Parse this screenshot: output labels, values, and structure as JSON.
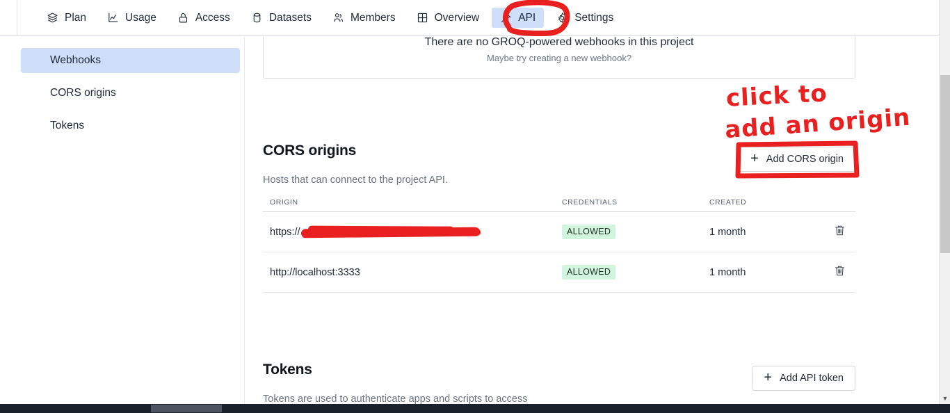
{
  "topnav": {
    "items": [
      {
        "label": "Plan",
        "icon": "layers-icon",
        "active": false
      },
      {
        "label": "Usage",
        "icon": "chart-line-icon",
        "active": false
      },
      {
        "label": "Access",
        "icon": "lock-icon",
        "active": false
      },
      {
        "label": "Datasets",
        "icon": "database-icon",
        "active": false
      },
      {
        "label": "Members",
        "icon": "users-icon",
        "active": false
      },
      {
        "label": "Overview",
        "icon": "grid-icon",
        "active": false
      },
      {
        "label": "API",
        "icon": "plug-icon",
        "active": true
      },
      {
        "label": "Settings",
        "icon": "gear-icon",
        "active": false
      }
    ]
  },
  "sidebar": {
    "items": [
      {
        "label": "Webhooks",
        "active": true
      },
      {
        "label": "CORS origins",
        "active": false
      },
      {
        "label": "Tokens",
        "active": false
      }
    ]
  },
  "webhooks_empty": {
    "title": "There are no GROQ-powered webhooks in this project",
    "subtitle": "Maybe try creating a new webhook?"
  },
  "cors": {
    "title": "CORS origins",
    "description": "Hosts that can connect to the project API.",
    "add_button_label": "Add CORS origin",
    "add_button_icon": "plus-icon",
    "columns": [
      "ORIGIN",
      "CREDENTIALS",
      "CREATED",
      ""
    ],
    "rows": [
      {
        "origin": "https://",
        "origin_redacted": true,
        "credentials": "ALLOWED",
        "created": "1 month",
        "delete_icon": "trash-icon"
      },
      {
        "origin": "http://localhost:3333",
        "origin_redacted": false,
        "credentials": "ALLOWED",
        "created": "1 month",
        "delete_icon": "trash-icon"
      }
    ]
  },
  "tokens": {
    "title": "Tokens",
    "description": "Tokens are used to authenticate apps and scripts to access",
    "add_button_label": "Add API token",
    "add_button_icon": "plus-icon"
  },
  "annotations": {
    "line1": "click to",
    "line2": "add an origin"
  },
  "colors": {
    "accent_active_tab": "#cfdffa",
    "marker_red": "#e8201f",
    "badge_green_bg": "#d2f5dd"
  }
}
